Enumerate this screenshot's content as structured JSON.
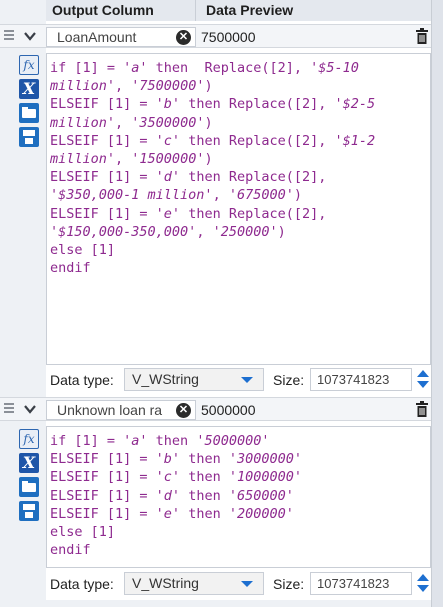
{
  "header": {
    "output_column": "Output Column",
    "data_preview": "Data Preview"
  },
  "colors": {
    "accent": "#1d6fd0",
    "keyword": "#8e2a8f",
    "header_bg": "#e4e8ee"
  },
  "formulas": [
    {
      "output_name": "LoanAmount",
      "preview_value": "7500000",
      "expression_lines": [
        [
          {
            "t": "if [1] = ",
            "c": "kw"
          },
          {
            "t": "'a'",
            "c": "str"
          },
          {
            "t": " then  Replace([2], ",
            "c": "kw"
          },
          {
            "t": "'$5-10",
            "c": "str"
          }
        ],
        [
          {
            "t": "million'",
            "c": "str"
          },
          {
            "t": ", ",
            "c": "kw"
          },
          {
            "t": "'7500000'",
            "c": "str"
          },
          {
            "t": ")",
            "c": "kw"
          }
        ],
        [
          {
            "t": "ELSEIF [1] = ",
            "c": "kw"
          },
          {
            "t": "'b'",
            "c": "str"
          },
          {
            "t": " then Replace([2], ",
            "c": "kw"
          },
          {
            "t": "'$2-5",
            "c": "str"
          }
        ],
        [
          {
            "t": "million'",
            "c": "str"
          },
          {
            "t": ", ",
            "c": "kw"
          },
          {
            "t": "'3500000'",
            "c": "str"
          },
          {
            "t": ")",
            "c": "kw"
          }
        ],
        [
          {
            "t": "ELSEIF [1] = ",
            "c": "kw"
          },
          {
            "t": "'c'",
            "c": "str"
          },
          {
            "t": " then Replace([2], ",
            "c": "kw"
          },
          {
            "t": "'$1-2",
            "c": "str"
          }
        ],
        [
          {
            "t": "million'",
            "c": "str"
          },
          {
            "t": ", ",
            "c": "kw"
          },
          {
            "t": "'1500000'",
            "c": "str"
          },
          {
            "t": ")",
            "c": "kw"
          }
        ],
        [
          {
            "t": "ELSEIF [1] = ",
            "c": "kw"
          },
          {
            "t": "'d'",
            "c": "str"
          },
          {
            "t": " then Replace([2],",
            "c": "kw"
          }
        ],
        [
          {
            "t": "'$350,000-1 million'",
            "c": "str"
          },
          {
            "t": ", ",
            "c": "kw"
          },
          {
            "t": "'675000'",
            "c": "str"
          },
          {
            "t": ")",
            "c": "kw"
          }
        ],
        [
          {
            "t": "ELSEIF [1] = ",
            "c": "kw"
          },
          {
            "t": "'e'",
            "c": "str"
          },
          {
            "t": " then Replace([2],",
            "c": "kw"
          }
        ],
        [
          {
            "t": "'$150,000-350,000'",
            "c": "str"
          },
          {
            "t": ", ",
            "c": "kw"
          },
          {
            "t": "'250000'",
            "c": "str"
          },
          {
            "t": ")",
            "c": "kw"
          }
        ],
        [
          {
            "t": "else [1]",
            "c": "kw"
          }
        ],
        [
          {
            "t": "endif",
            "c": "kw"
          }
        ]
      ],
      "data_type_label": "Data type:",
      "data_type": "V_WString",
      "size_label": "Size:",
      "size": "1073741823"
    },
    {
      "output_name": "Unknown loan ra",
      "preview_value": "5000000",
      "expression_lines": [
        [
          {
            "t": "if [1] = ",
            "c": "kw"
          },
          {
            "t": "'a'",
            "c": "str"
          },
          {
            "t": " then ",
            "c": "kw"
          },
          {
            "t": "'5000000'",
            "c": "str"
          }
        ],
        [
          {
            "t": "ELSEIF [1] = ",
            "c": "kw"
          },
          {
            "t": "'b'",
            "c": "str"
          },
          {
            "t": " then ",
            "c": "kw"
          },
          {
            "t": "'3000000'",
            "c": "str"
          }
        ],
        [
          {
            "t": "ELSEIF [1] = ",
            "c": "kw"
          },
          {
            "t": "'c'",
            "c": "str"
          },
          {
            "t": " then ",
            "c": "kw"
          },
          {
            "t": "'1000000'",
            "c": "str"
          }
        ],
        [
          {
            "t": "ELSEIF [1] = ",
            "c": "kw"
          },
          {
            "t": "'d'",
            "c": "str"
          },
          {
            "t": " then ",
            "c": "kw"
          },
          {
            "t": "'650000'",
            "c": "str"
          }
        ],
        [
          {
            "t": "ELSEIF [1] = ",
            "c": "kw"
          },
          {
            "t": "'e'",
            "c": "str"
          },
          {
            "t": " then ",
            "c": "kw"
          },
          {
            "t": "'200000'",
            "c": "str"
          }
        ],
        [
          {
            "t": "else [1]",
            "c": "kw"
          }
        ],
        [
          {
            "t": "endif",
            "c": "kw"
          }
        ]
      ],
      "data_type_label": "Data type:",
      "data_type": "V_WString",
      "size_label": "Size:",
      "size": "1073741823"
    }
  ]
}
